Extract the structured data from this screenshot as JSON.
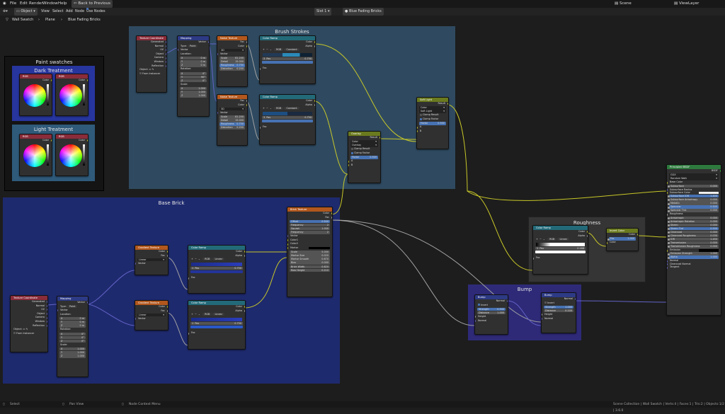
{
  "menu": {
    "file": "File",
    "edit": "Edit",
    "render": "Render",
    "window": "Window",
    "help": "Help",
    "back": "Back to Previous",
    "scene": "Scene",
    "viewlayer": "ViewLayer"
  },
  "header": {
    "mode": "Object",
    "view": "View",
    "select": "Select",
    "add": "Add",
    "node": "Node",
    "use_nodes": "Use Nodes",
    "slot": "Slot 1",
    "material": "Blue Fading Bricks"
  },
  "breadcrumb": {
    "object": "Wall Swatch",
    "mesh": "Plane",
    "material": "Blue Fading Bricks"
  },
  "frames": {
    "paint": "Paint swatches",
    "dark": "Dark Treatment",
    "light": "Light Treatment",
    "brush": "Brush Strokes",
    "base": "Base Brick",
    "rough": "Roughness",
    "bump": "Bump"
  },
  "nodes": {
    "rgb": "RGB",
    "color": "Color",
    "texcoord": {
      "title": "Texture Coordinate",
      "outs": [
        "Generated",
        "Normal",
        "UV",
        "Object",
        "Camera",
        "Window",
        "Reflection"
      ],
      "object": "Object:",
      "from_instancer": "From Instancer"
    },
    "mapping": {
      "title": "Mapping",
      "vector": "Vector",
      "type_label": "Type:",
      "type": "Point",
      "location": "Location:",
      "rotation": "Rotation:",
      "scale": "Scale:",
      "x": "X",
      "y": "Y",
      "z": "Z",
      "loc": [
        "0 m",
        "0 m",
        "0 m"
      ],
      "rot": [
        "0°",
        "90°",
        "0°"
      ],
      "rot2": [
        "0°",
        "0°",
        "0°"
      ],
      "scl": [
        "1.000",
        "1.000",
        "1.000"
      ]
    },
    "noise": {
      "title": "Noise Texture",
      "fac": "Fac",
      "color": "Color",
      "dim": "3D",
      "vector": "Vector",
      "scale": "Scale",
      "scale_v1": "61.200",
      "scale_v2": "61.200",
      "detail": "Detail",
      "detail_v": "15.000",
      "rough": "Roughness",
      "rough_v": "0.750",
      "dist": "Distortion",
      "dist_v": "0.200"
    },
    "ramp": {
      "title": "Color Ramp",
      "color": "Color",
      "alpha": "Alpha",
      "rgb": "RGB",
      "interp1": "Constant",
      "interp2": "Linear",
      "pos": "Pos",
      "pos1": "0.750",
      "pos2": "0.750",
      "pos3": "0.168",
      "idx1": "3",
      "idx2": "1",
      "fac": "Fac"
    },
    "softlight": {
      "title": "Soft Light",
      "result": "Result",
      "type": "Color",
      "blend": "Soft Light",
      "clamp_r": "Clamp Result",
      "clamp_f": "Clamp Factor",
      "factor": "Factor",
      "factor_v": "0.500",
      "a": "A",
      "b": "B"
    },
    "overlay": {
      "title": "Overlay",
      "result": "Result",
      "type": "Color",
      "blend": "Overlay",
      "clamp_r": "Clamp Result",
      "clamp_f": "Clamp Factor",
      "factor": "Factor",
      "factor_v": "0.500",
      "a": "A",
      "b": "B"
    },
    "gradient": {
      "title": "Gradient Texture",
      "color": "Color",
      "fac": "Fac",
      "type": "Linear",
      "vector": "Vector"
    },
    "brick": {
      "title": "Brick Texture",
      "color": "Color",
      "fac": "Fac",
      "offset": "Offset",
      "offset_v": "0.500",
      "freq": "Frequency",
      "freq_v": "2",
      "squash": "Squash",
      "squash_v": "1.000",
      "freq2_v": "2",
      "vector": "Vector",
      "c1": "Color1",
      "c2": "Color2",
      "mortar": "Mortar",
      "scale": "Scale",
      "scale_v": "5.000",
      "msize": "Mortar Size",
      "msize_v": "0.020",
      "msmooth": "Mortar Smooth",
      "msmooth_v": "0.670",
      "bias": "Bias",
      "bias_v": "0.000",
      "bw": "Brick Width",
      "bw_v": "0.620",
      "rh": "Row Height",
      "rh_v": "0.210"
    },
    "invert": {
      "title": "Invert Color",
      "color": "Color",
      "fac": "Fac",
      "fac_v": "1.000"
    },
    "bump": {
      "title": "Bump",
      "normal": "Normal",
      "invert": "Invert",
      "strength": "Strength",
      "strength_v1": "0.500",
      "strength_v2": "1.000",
      "distance": "Distance",
      "distance_v1": "1.000",
      "distance_v2": "0.100",
      "height": "Height"
    },
    "bsdf": {
      "title": "Principled BSDF",
      "out": "BSDF",
      "dist": "GGX",
      "sss": "Random Walk",
      "inputs": [
        [
          "Base Color",
          ""
        ],
        [
          "Subsurface",
          "0.000"
        ],
        [
          "Subsurface Radius",
          ""
        ],
        [
          "Subsurface Color",
          ""
        ],
        [
          "Subsurface IOR",
          "1.400"
        ],
        [
          "Subsurface Anisotropy",
          "0.000"
        ],
        [
          "Metallic",
          "0.000"
        ],
        [
          "Specular",
          "0.500"
        ],
        [
          "Specular Tint",
          "0.000"
        ],
        [
          "Roughness",
          ""
        ],
        [
          "Anisotropic",
          "0.000"
        ],
        [
          "Anisotropic Rotation",
          "0.000"
        ],
        [
          "Sheen",
          "0.000"
        ],
        [
          "Sheen Tint",
          "0.500"
        ],
        [
          "Clearcoat",
          "0.000"
        ],
        [
          "Clearcoat Roughness",
          "0.030"
        ],
        [
          "IOR",
          "1.450"
        ],
        [
          "Transmission",
          "0.000"
        ],
        [
          "Transmission Roughness",
          "0.000"
        ],
        [
          "Emission",
          ""
        ],
        [
          "Emission Strength",
          "1.000"
        ],
        [
          "Alpha",
          "1.000"
        ],
        [
          "Normal",
          ""
        ],
        [
          "Clearcoat Normal",
          ""
        ],
        [
          "Tangent",
          ""
        ]
      ]
    }
  },
  "status": {
    "select": "Select",
    "pan": "Pan View",
    "context": "Node Context Menu",
    "info": "Scene Collection | Wall Swatch | Verts:4 | Faces:1 | Tris:2 | Objects:1/2 | 3.6.0"
  },
  "colors": {
    "frame_blue": "#2f4a60",
    "frame_navy": "#1e2a6e",
    "frame_purple": "#2e2a78",
    "frame_gray": "#353535",
    "header_red": "#8a2c3a",
    "header_blue": "#2d5f85",
    "header_orange": "#b2571d",
    "header_green": "#6a8a2a",
    "header_teal": "#236a79"
  }
}
